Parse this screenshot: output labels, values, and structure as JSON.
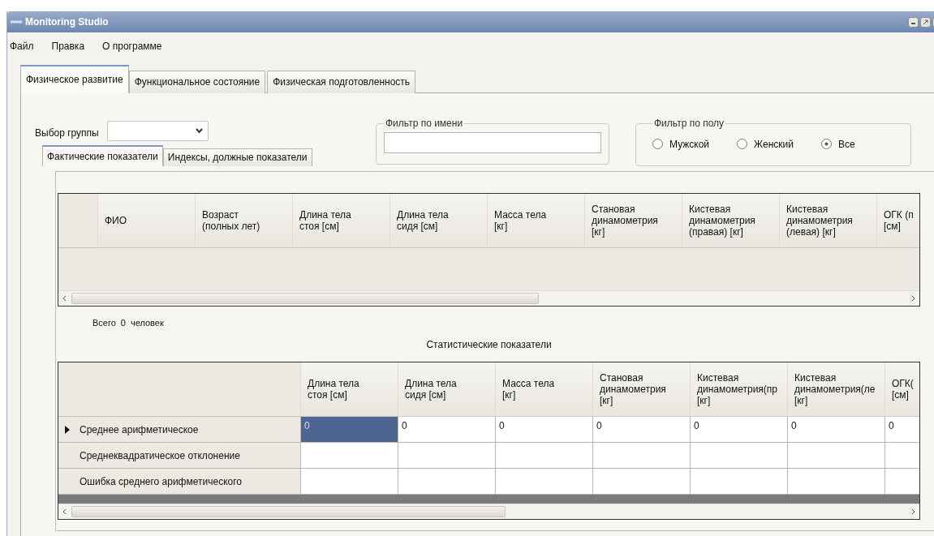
{
  "window": {
    "title": "Monitoring Studio"
  },
  "menu": [
    "Файл",
    "Правка",
    "О программе"
  ],
  "tabs": [
    {
      "label": "Физическое развитие",
      "selected": true
    },
    {
      "label": "Функциональное состояние",
      "selected": false
    },
    {
      "label": "Физическая подготовленность",
      "selected": false
    }
  ],
  "group_select": {
    "label": "Выбор группы"
  },
  "subtabs": [
    {
      "label": "Фактические показатели",
      "selected": true
    },
    {
      "label": "Индексы, должные показатели",
      "selected": false
    }
  ],
  "name_filter": {
    "legend": "Фильтр по имени"
  },
  "sex_filter": {
    "legend": "Фильтр по полу",
    "options": [
      {
        "label": "Мужской",
        "selected": false
      },
      {
        "label": "Женский",
        "selected": false
      },
      {
        "label": "Все",
        "selected": true
      }
    ]
  },
  "data_table": {
    "columns": [
      "ФИО",
      "Возраст\n(полных лет)",
      "Длина тела\nстоя [см]",
      "Длина тела\nсидя [см]",
      "Масса тела\n[кг]",
      "Становая\nдинамометрия\n[кг]",
      "Кистевая\nдинамометрия\n(правая) [кг]",
      "Кистевая\nдинамометрия\n(левая) [кг]",
      "ОГК (п\n[см]"
    ]
  },
  "total": {
    "label": "Всего",
    "count": "0",
    "unit": "человек"
  },
  "stats_title": "Статистические показатели",
  "stats_table": {
    "columns": [
      "Длина тела\nстоя [см]",
      "Длина тела\nсидя [см]",
      "Масса тела\n[кг]",
      "Становая\nдинамометрия\n[кг]",
      "Кистевая\nдинамометрия(пр\n[кг]",
      "Кистевая\nдинамометрия(ле\n[кг]",
      "ОГК(\n[см]"
    ],
    "rows": [
      {
        "label": "Среднее арифметическое",
        "current": true,
        "cells": [
          {
            "value": "0",
            "selected": true
          },
          {
            "value": "0",
            "selected": false
          },
          {
            "value": "0",
            "selected": false
          },
          {
            "value": "0",
            "selected": false
          },
          {
            "value": "0",
            "selected": false
          },
          {
            "value": "0",
            "selected": false
          },
          {
            "value": "0",
            "selected": false
          }
        ]
      },
      {
        "label": "Среднеквадратическое отклонение",
        "current": false
      },
      {
        "label": "Ошибка среднего арифметического",
        "current": false
      }
    ]
  }
}
